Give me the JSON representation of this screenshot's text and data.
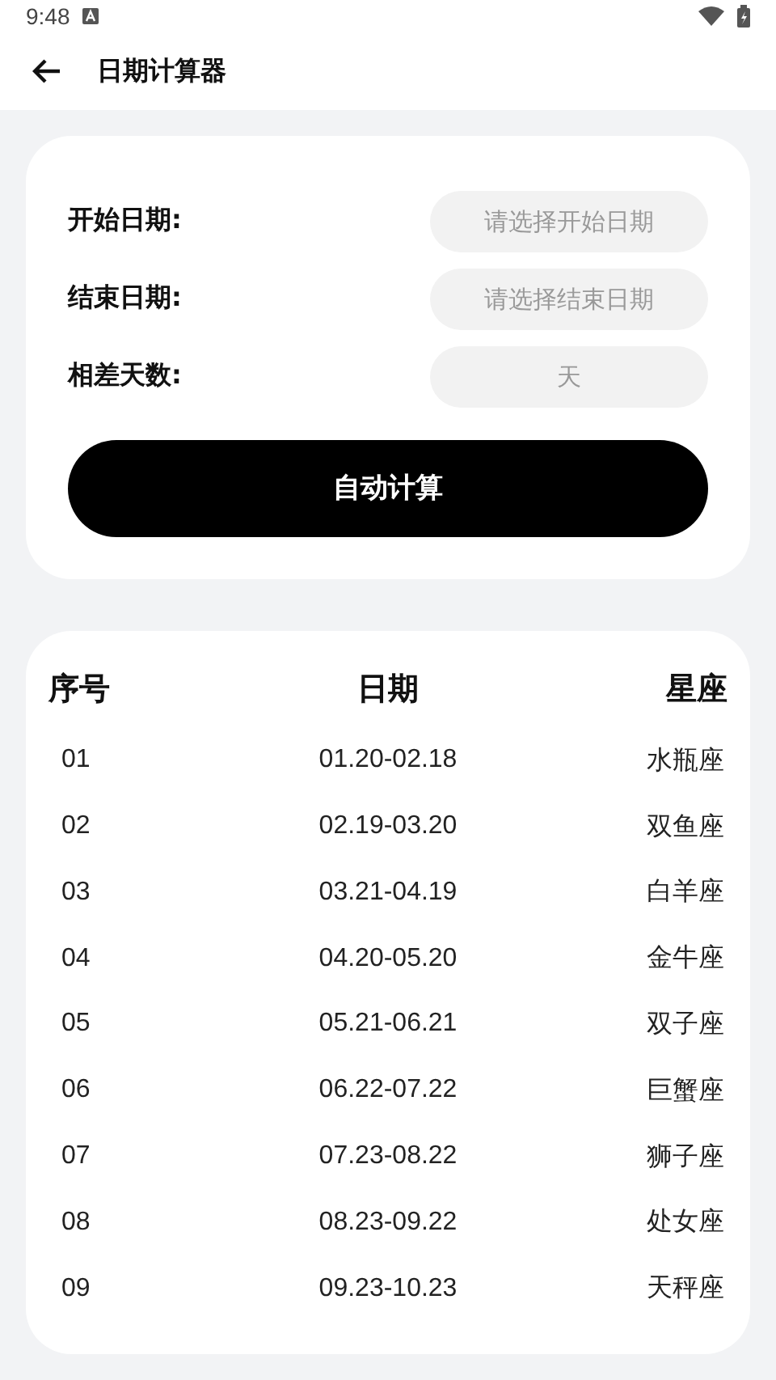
{
  "status_bar": {
    "time": "9:48"
  },
  "app_bar": {
    "title": "日期计算器"
  },
  "form": {
    "fields": [
      {
        "label": "开始日期:",
        "placeholder": "请选择开始日期"
      },
      {
        "label": "结束日期:",
        "placeholder": "请选择结束日期"
      },
      {
        "label": "相差天数:",
        "placeholder": "天"
      }
    ],
    "button": "自动计算"
  },
  "table": {
    "columns": [
      "序号",
      "日期",
      "星座"
    ],
    "rows": [
      [
        "01",
        "01.20-02.18",
        "水瓶座"
      ],
      [
        "02",
        "02.19-03.20",
        "双鱼座"
      ],
      [
        "03",
        "03.21-04.19",
        "白羊座"
      ],
      [
        "04",
        "04.20-05.20",
        "金牛座"
      ],
      [
        "05",
        "05.21-06.21",
        "双子座"
      ],
      [
        "06",
        "06.22-07.22",
        "巨蟹座"
      ],
      [
        "07",
        "07.23-08.22",
        "狮子座"
      ],
      [
        "08",
        "08.23-09.22",
        "处女座"
      ],
      [
        "09",
        "09.23-10.23",
        "天秤座"
      ]
    ]
  }
}
